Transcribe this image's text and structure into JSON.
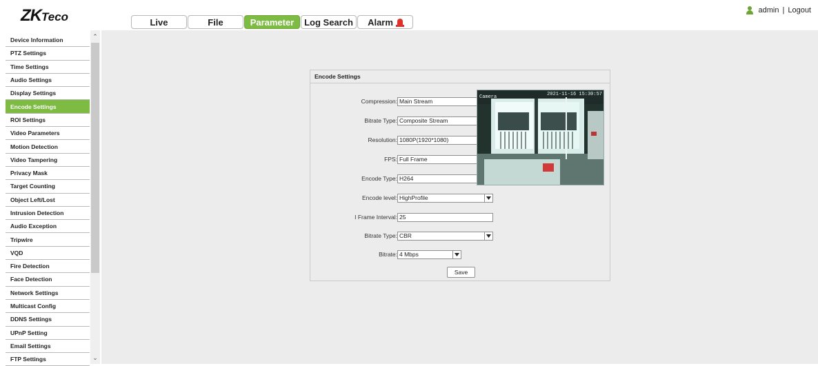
{
  "brand": {
    "logo_zk": "ZK",
    "logo_teco": "Teco"
  },
  "tabs": [
    {
      "label": "Live"
    },
    {
      "label": "File"
    },
    {
      "label": "Parameter",
      "active": true
    },
    {
      "label": "Log Search"
    },
    {
      "label": "Alarm"
    }
  ],
  "user": {
    "name": "admin",
    "logout": "Logout",
    "separator": "|"
  },
  "sidebar": {
    "items": [
      "Device Information",
      "PTZ Settings",
      "Time Settings",
      "Audio Settings",
      "Display Settings",
      "Encode Settings",
      "ROI Settings",
      "Video Parameters",
      "Motion Detection",
      "Video Tampering",
      "Privacy Mask",
      "Target Counting",
      "Object Left/Lost",
      "Intrusion Detection",
      "Audio Exception",
      "Tripwire",
      "VQD",
      "Fire Detection",
      "Face Detection",
      "Network Settings",
      "Multicast Config",
      "DDNS Settings",
      "UPnP Setting",
      "Email Settings",
      "FTP Settings"
    ],
    "active_index": 5
  },
  "panel": {
    "title": "Encode Settings",
    "fields": {
      "compression": {
        "label": "Compression:",
        "value": "Main Stream"
      },
      "bitrate_type_1": {
        "label": "Bitrate Type:",
        "value": "Composite Stream"
      },
      "resolution": {
        "label": "Resolution:",
        "value": "1080P(1920*1080)"
      },
      "fps": {
        "label": "FPS:",
        "value": "Full Frame"
      },
      "encode_type": {
        "label": "Encode Type:",
        "value": "H264"
      },
      "encode_level": {
        "label": "Encode level:",
        "value": "HighProfile"
      },
      "iframe_interval": {
        "label": "I Frame Interval:",
        "value": "25"
      },
      "bitrate_type_2": {
        "label": "Bitrate Type:",
        "value": "CBR"
      },
      "bitrate": {
        "label": "Bitrate:",
        "value": "4 Mbps"
      }
    },
    "save_label": "Save"
  },
  "preview": {
    "osd_name": "Camera",
    "osd_time": "2021-11-16 15:30:57"
  },
  "colors": {
    "accent": "#7dbb42",
    "background": "#ececec"
  }
}
